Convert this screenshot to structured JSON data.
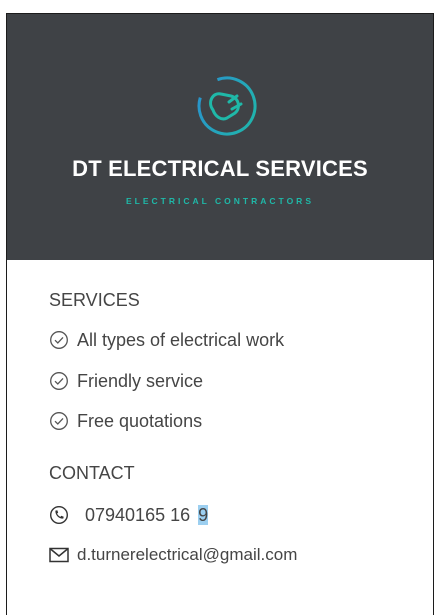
{
  "header": {
    "company_name": "DT ELECTRICAL SERVICES",
    "tagline": "ELECTRICAL CONTRACTORS",
    "logo_icon": "plug-icon",
    "colors": {
      "background": "#3f4246",
      "accent": "#1fb8a8"
    }
  },
  "services": {
    "title": "SERVICES",
    "items": [
      {
        "icon": "check-circle-icon",
        "label": "All types of electrical work"
      },
      {
        "icon": "check-circle-icon",
        "label": "Friendly service"
      },
      {
        "icon": "check-circle-icon",
        "label": "Free quotations"
      }
    ]
  },
  "contact": {
    "title": "CONTACT",
    "phone_icon": "phone-icon",
    "phone_prefix": "07940165 16",
    "phone_selected": "9",
    "email_icon": "envelope-icon",
    "email": "d.turnerelectrical@gmail.com"
  }
}
